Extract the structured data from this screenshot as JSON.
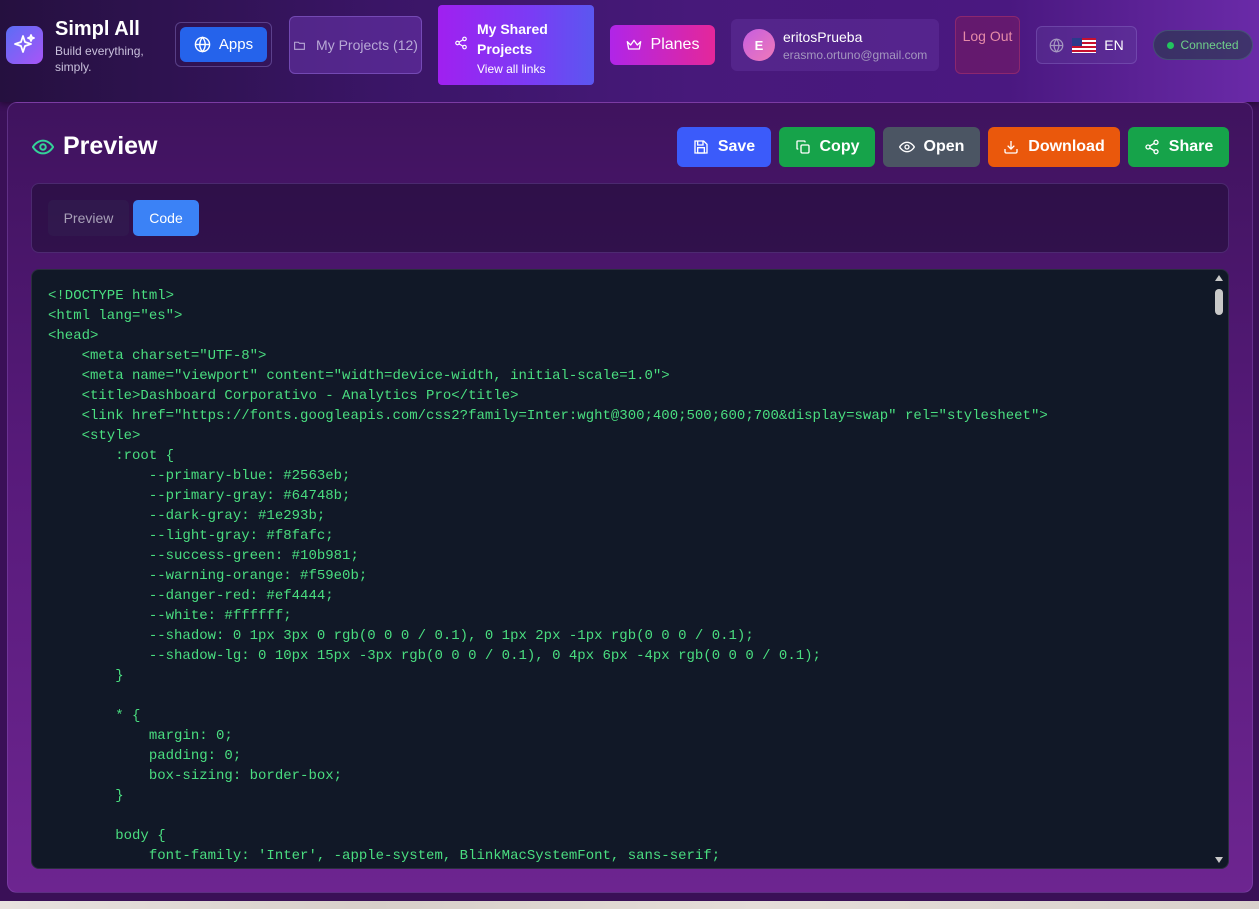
{
  "brand": {
    "name": "Simpl All",
    "tagline": "Build everything, simply."
  },
  "nav": {
    "apps_label": "Apps",
    "projects_label": "My Projects (12)",
    "shared": {
      "title": "My Shared Projects",
      "subtitle": "View all links"
    },
    "plans_label": "Planes"
  },
  "user": {
    "initial": "E",
    "name": "eritosPrueba",
    "email": "erasmo.ortuno@gmail.com"
  },
  "logout_label": "Log Out",
  "language": {
    "code": "EN"
  },
  "status": {
    "label": "Connected",
    "color": "#22c55e"
  },
  "panel": {
    "title": "Preview",
    "actions": {
      "save": "Save",
      "copy": "Copy",
      "open": "Open",
      "download": "Download",
      "share": "Share"
    },
    "tabs": {
      "preview": "Preview",
      "code": "Code",
      "active": "Code"
    }
  },
  "code": "<!DOCTYPE html>\n<html lang=\"es\">\n<head>\n    <meta charset=\"UTF-8\">\n    <meta name=\"viewport\" content=\"width=device-width, initial-scale=1.0\">\n    <title>Dashboard Corporativo - Analytics Pro</title>\n    <link href=\"https://fonts.googleapis.com/css2?family=Inter:wght@300;400;500;600;700&display=swap\" rel=\"stylesheet\">\n    <style>\n        :root {\n            --primary-blue: #2563eb;\n            --primary-gray: #64748b;\n            --dark-gray: #1e293b;\n            --light-gray: #f8fafc;\n            --success-green: #10b981;\n            --warning-orange: #f59e0b;\n            --danger-red: #ef4444;\n            --white: #ffffff;\n            --shadow: 0 1px 3px 0 rgb(0 0 0 / 0.1), 0 1px 2px -1px rgb(0 0 0 / 0.1);\n            --shadow-lg: 0 10px 15px -3px rgb(0 0 0 / 0.1), 0 4px 6px -4px rgb(0 0 0 / 0.1);\n        }\n\n        * {\n            margin: 0;\n            padding: 0;\n            box-sizing: border-box;\n        }\n\n        body {\n            font-family: 'Inter', -apple-system, BlinkMacSystemFont, sans-serif;",
  "colors": {
    "save": "#3b5bfa",
    "copy": "#16a34a",
    "open": "#4b5563",
    "download": "#ea580c",
    "share": "#16a34a",
    "code_text": "#4ade80",
    "code_bg": "#111827"
  },
  "icons": [
    "sparkles-icon",
    "globe-icon",
    "folder-icon",
    "share-icon",
    "crown-icon",
    "flag-us-icon",
    "eye-icon",
    "save-icon",
    "copy-icon",
    "download-icon"
  ]
}
